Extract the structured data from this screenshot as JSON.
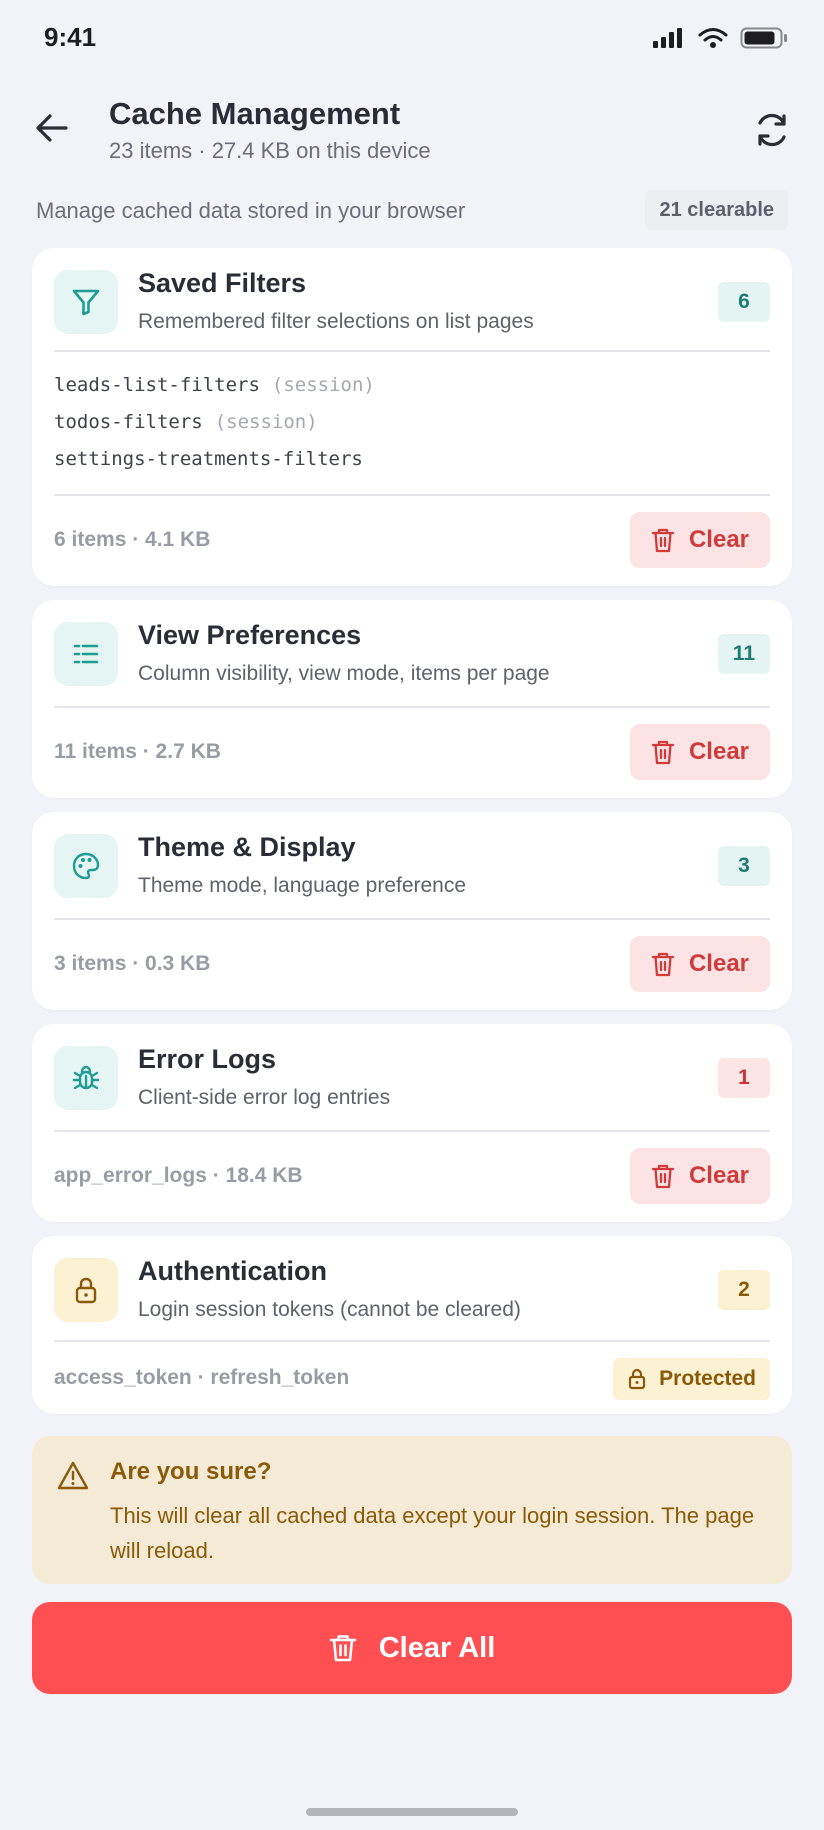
{
  "status_bar": {
    "time": "9:41"
  },
  "header": {
    "title": "Cache Management",
    "subtitle": "23 items · 27.4 KB on this device"
  },
  "intro": {
    "text": "Manage cached data stored in your browser",
    "clearable": "21 clearable"
  },
  "cards": {
    "saved_filters": {
      "title": "Saved Filters",
      "description": "Remembered filter selections on list pages",
      "count": "6",
      "keys": [
        {
          "name": "leads-list-filters",
          "tag": "(session)"
        },
        {
          "name": "todos-filters",
          "tag": "(session)"
        },
        {
          "name": "settings-treatments-filters",
          "tag": ""
        }
      ],
      "footer": "6 items · 4.1 KB",
      "clear_label": "Clear"
    },
    "view_preferences": {
      "title": "View Preferences",
      "description": "Column visibility, view mode, items per page",
      "count": "11",
      "footer": "11 items · 2.7 KB",
      "clear_label": "Clear"
    },
    "theme_display": {
      "title": "Theme & Display",
      "description": "Theme mode, language preference",
      "count": "3",
      "footer": "3 items · 0.3 KB",
      "clear_label": "Clear"
    },
    "error_logs": {
      "title": "Error Logs",
      "description": "Client-side error log entries",
      "count": "1",
      "footer": "app_error_logs · 18.4 KB",
      "clear_label": "Clear"
    },
    "authentication": {
      "title": "Authentication",
      "description": "Login session tokens (cannot be cleared)",
      "count": "2",
      "footer": "access_token · refresh_token",
      "protected_label": "Protected"
    }
  },
  "warning": {
    "title": "Are you sure?",
    "body": "This will clear all cached data except your login session. The page will reload."
  },
  "clear_all_label": "Clear All",
  "colors": {
    "teal": "#1f9c93",
    "danger": "#ff4f52",
    "amber": "#8a5a08"
  },
  "icons": {
    "saved_filters": "funnel-icon",
    "view_preferences": "list-icon",
    "theme_display": "palette-icon",
    "error_logs": "bug-icon",
    "authentication": "lock-icon"
  }
}
